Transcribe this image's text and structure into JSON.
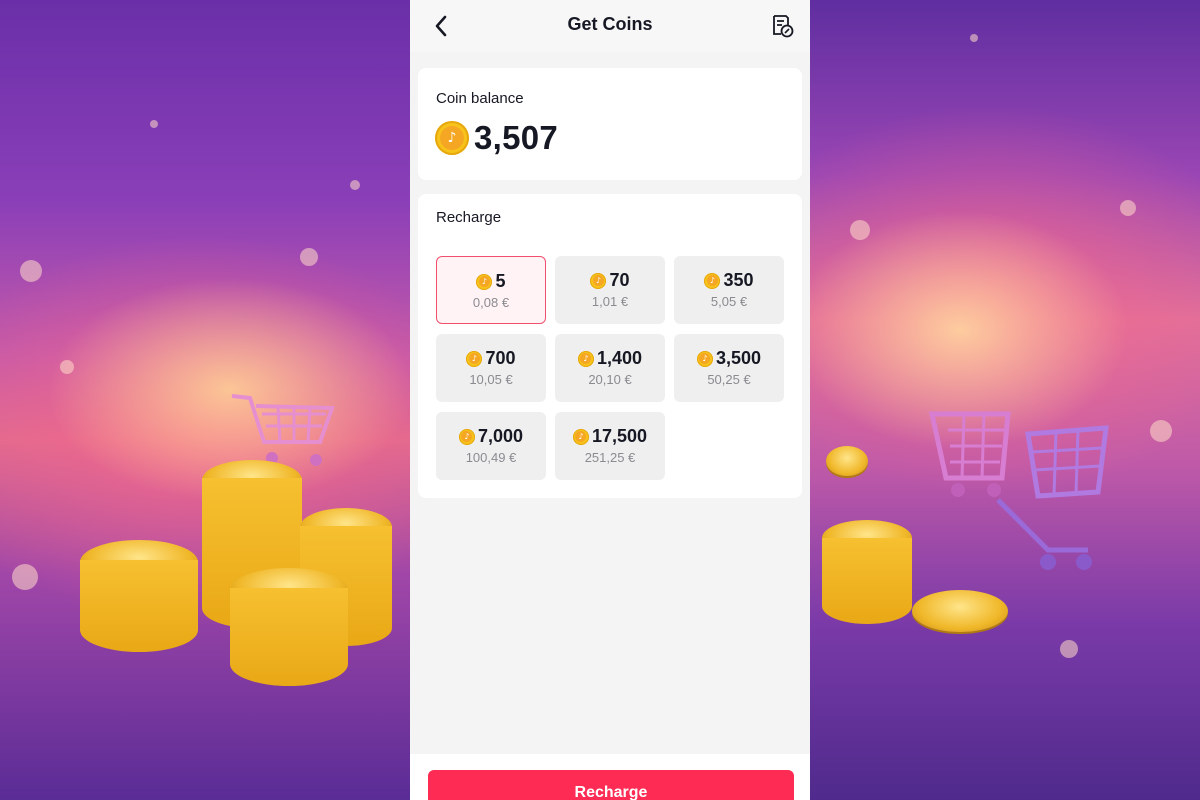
{
  "header": {
    "title": "Get Coins"
  },
  "balance": {
    "label": "Coin balance",
    "value": "3,507"
  },
  "recharge": {
    "label": "Recharge",
    "options": [
      {
        "amount": "5",
        "price": "0,08 €",
        "selected": true
      },
      {
        "amount": "70",
        "price": "1,01 €",
        "selected": false
      },
      {
        "amount": "350",
        "price": "5,05 €",
        "selected": false
      },
      {
        "amount": "700",
        "price": "10,05 €",
        "selected": false
      },
      {
        "amount": "1,400",
        "price": "20,10 €",
        "selected": false
      },
      {
        "amount": "3,500",
        "price": "50,25 €",
        "selected": false
      },
      {
        "amount": "7,000",
        "price": "100,49 €",
        "selected": false
      },
      {
        "amount": "17,500",
        "price": "251,25 €",
        "selected": false
      }
    ]
  },
  "footer": {
    "button_label": "Recharge"
  },
  "colors": {
    "accent": "#fe2c55",
    "selected_border": "#f0506e",
    "coin": "#f7c31a"
  },
  "icons": {
    "back": "chevron-left-icon",
    "history": "transaction-history-icon",
    "coin": "tiktok-coin-icon"
  }
}
